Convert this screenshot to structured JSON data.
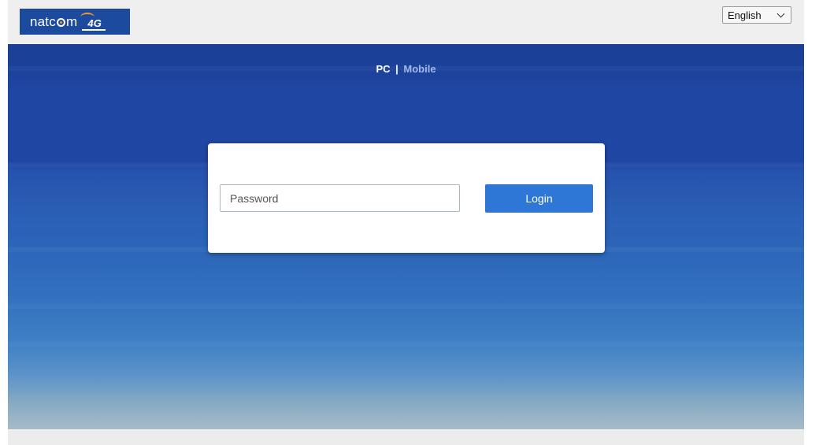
{
  "header": {
    "logo": {
      "text_before": "natc",
      "text_after": "m",
      "badge": "4G"
    },
    "language": {
      "selected": "English"
    }
  },
  "hero": {
    "mode_switch": {
      "pc": "PC",
      "separator": "|",
      "mobile": "Mobile"
    }
  },
  "login": {
    "password_placeholder": "Password",
    "password_value": "",
    "login_label": "Login"
  },
  "colors": {
    "brand_blue": "#1c4a9e",
    "accent_orange": "#f29a2e",
    "button_blue": "#2e77d6"
  }
}
